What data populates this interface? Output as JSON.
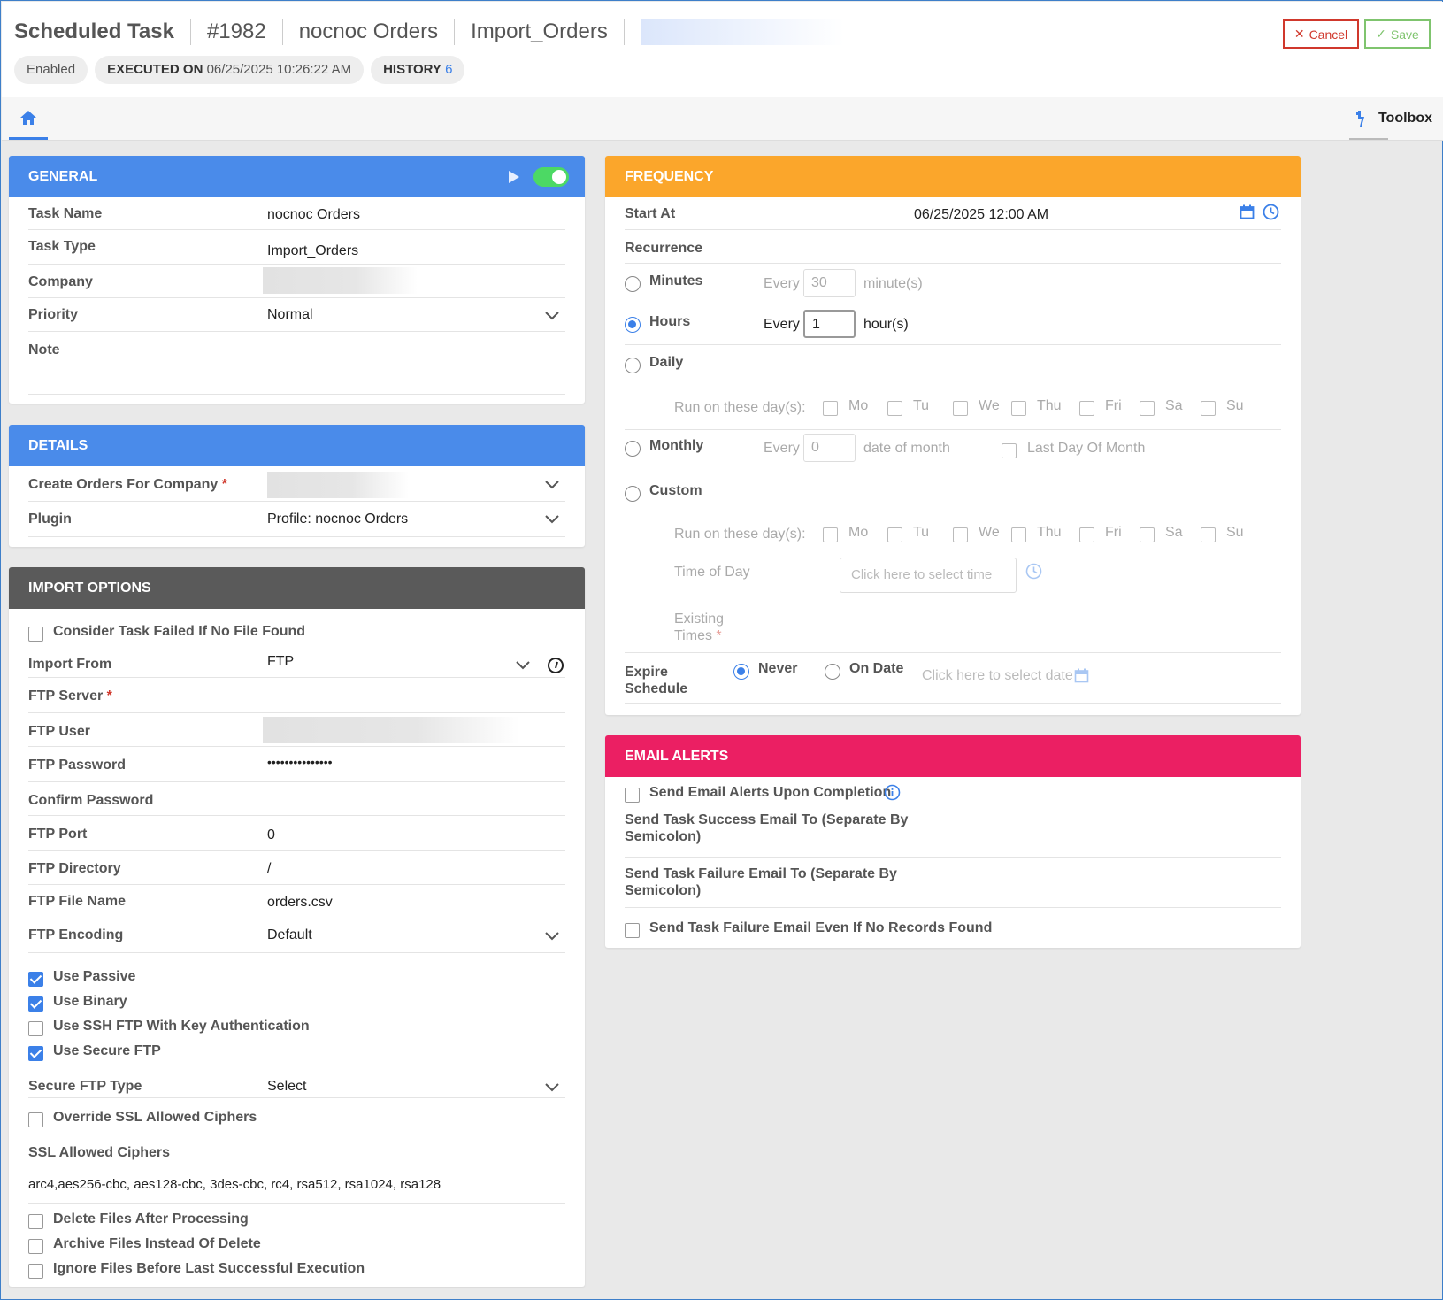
{
  "header": {
    "title": "Scheduled Task",
    "task_id": "#1982",
    "task_name": "nocnoc Orders",
    "task_type": "Import_Orders",
    "chips": {
      "status": "Enabled",
      "executed_label": "EXECUTED ON",
      "executed_value": "06/25/2025 10:26:22 AM",
      "history_label": "HISTORY",
      "history_count": "6"
    },
    "cancel_label": "Cancel",
    "save_label": "Save"
  },
  "tabbar": {
    "toolbox_label": "Toolbox"
  },
  "general": {
    "title": "GENERAL",
    "task_name_label": "Task Name",
    "task_name_value": "nocnoc Orders",
    "task_type_label": "Task Type",
    "task_type_value": "Import_Orders",
    "company_label": "Company",
    "priority_label": "Priority",
    "priority_value": "Normal",
    "note_label": "Note"
  },
  "details": {
    "title": "DETAILS",
    "create_for_label": "Create Orders For Company",
    "plugin_label": "Plugin",
    "plugin_value": "Profile: nocnoc Orders"
  },
  "import_options": {
    "title": "IMPORT OPTIONS",
    "consider_failed_label": "Consider Task Failed If No File Found",
    "import_from_label": "Import From",
    "import_from_value": "FTP",
    "ftp_server_label": "FTP Server",
    "ftp_user_label": "FTP User",
    "ftp_password_label": "FTP Password",
    "ftp_password_value": "•••••••••••••••",
    "confirm_password_label": "Confirm Password",
    "ftp_port_label": "FTP Port",
    "ftp_port_value": "0",
    "ftp_directory_label": "FTP Directory",
    "ftp_directory_value": "/",
    "ftp_file_name_label": "FTP File Name",
    "ftp_file_name_value": "orders.csv",
    "ftp_encoding_label": "FTP Encoding",
    "ftp_encoding_value": "Default",
    "use_passive_label": "Use Passive",
    "use_binary_label": "Use Binary",
    "use_ssh_label": "Use SSH FTP With Key Authentication",
    "use_secure_label": "Use Secure FTP",
    "secure_type_label": "Secure FTP Type",
    "secure_type_value": "Select",
    "override_ssl_label": "Override SSL Allowed Ciphers",
    "ssl_ciphers_label": "SSL Allowed Ciphers",
    "ssl_ciphers_value": "arc4,aes256-cbc, aes128-cbc, 3des-cbc, rc4, rsa512, rsa1024, rsa128",
    "delete_files_label": "Delete Files After Processing",
    "archive_files_label": "Archive Files Instead Of Delete",
    "ignore_files_label": "Ignore Files Before Last Successful Execution"
  },
  "frequency": {
    "title": "FREQUENCY",
    "start_at_label": "Start At",
    "start_at_value": "06/25/2025 12:00 AM",
    "recurrence_label": "Recurrence",
    "minutes_label": "Minutes",
    "every_label": "Every",
    "minutes_value": "30",
    "minutes_unit": "minute(s)",
    "hours_label": "Hours",
    "hours_value": "1",
    "hours_unit": "hour(s)",
    "daily_label": "Daily",
    "run_days_label": "Run on these day(s):",
    "days": [
      "Mo",
      "Tu",
      "We",
      "Thu",
      "Fri",
      "Sa",
      "Su"
    ],
    "monthly_label": "Monthly",
    "monthly_value": "0",
    "date_of_month": "date of month",
    "last_day_label": "Last Day Of Month",
    "custom_label": "Custom",
    "time_of_day_label": "Time of Day",
    "time_placeholder": "Click here to select time",
    "existing_times_1": "Existing",
    "existing_times_2": "Times",
    "expire_label_1": "Expire",
    "expire_label_2": "Schedule",
    "never_label": "Never",
    "on_date_label": "On Date",
    "date_placeholder": "Click here to select date"
  },
  "email_alerts": {
    "title": "EMAIL ALERTS",
    "send_upon_label": "Send Email Alerts Upon Completion",
    "success_label_1": "Send Task Success Email To (Separate By",
    "success_label_2": "Semicolon)",
    "failure_label_1": "Send Task Failure Email To (Separate By",
    "failure_label_2": "Semicolon)",
    "failure_no_records_label": "Send Task Failure Email Even If No Records Found"
  },
  "colors": {
    "blue_header": "#4a8bea",
    "dark_header": "#5a5a5a",
    "orange_header": "#fba62b",
    "pink_header": "#eb1f63",
    "accent": "#3b80e8",
    "cancel": "#d0382c",
    "save": "#7fc46e"
  },
  "icons": [
    "home-icon",
    "toolbox-icon",
    "play-icon",
    "toggle-switch",
    "chevron-down-icon",
    "calendar-icon",
    "clock-icon",
    "info-icon",
    "check-icon",
    "close-icon"
  ]
}
